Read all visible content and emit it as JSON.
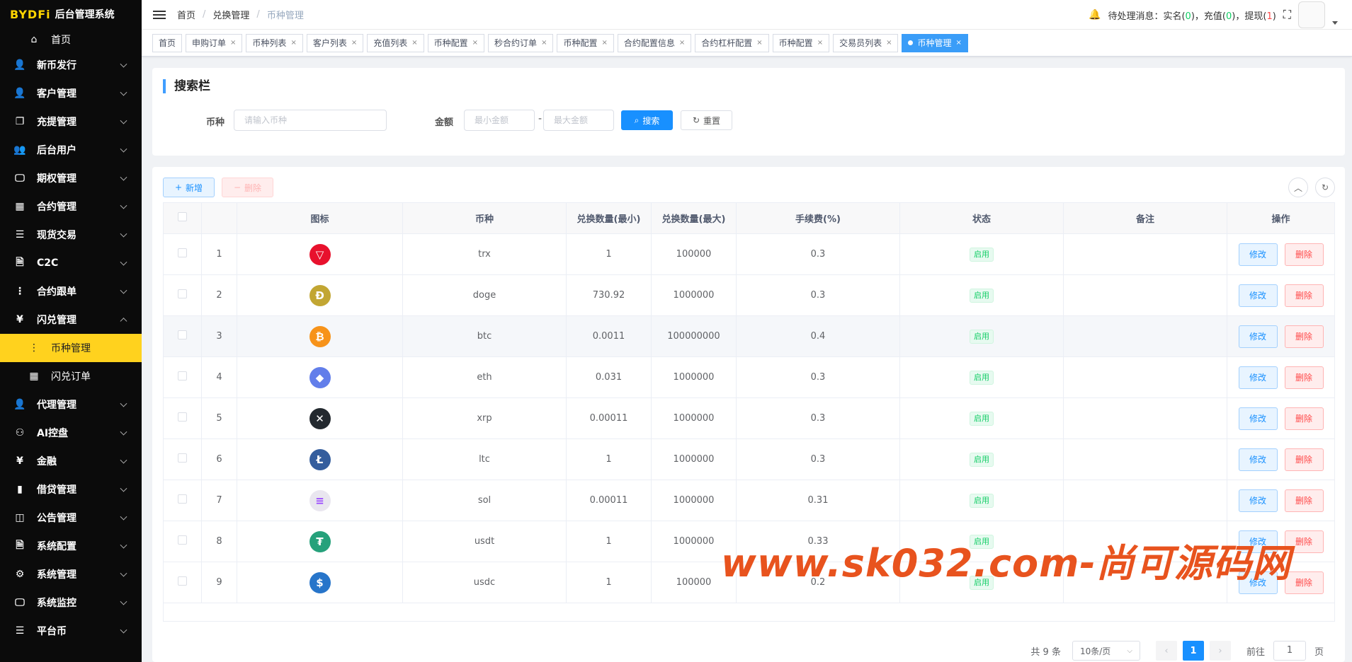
{
  "brand": {
    "logo": "BYDFi",
    "title": "后台管理系统"
  },
  "sidebar": {
    "home": "首页",
    "items": [
      {
        "label": "新币发行",
        "icon": "user-icon"
      },
      {
        "label": "客户管理",
        "icon": "user-icon"
      },
      {
        "label": "充提管理",
        "icon": "copy-icon"
      },
      {
        "label": "后台用户",
        "icon": "users-icon"
      },
      {
        "label": "期权管理",
        "icon": "monitor-icon"
      },
      {
        "label": "合约管理",
        "icon": "table-icon"
      },
      {
        "label": "现货交易",
        "icon": "list-icon"
      },
      {
        "label": "C2C",
        "icon": "document-icon"
      },
      {
        "label": "合约跟单",
        "icon": "tree-icon"
      },
      {
        "label": "闪兑管理",
        "icon": "yen-icon"
      }
    ],
    "sub_items": [
      {
        "label": "币种管理",
        "icon": "tree-icon",
        "active": true
      },
      {
        "label": "闪兑订单",
        "icon": "table-icon",
        "active": false
      }
    ],
    "items_after": [
      {
        "label": "代理管理",
        "icon": "user-icon"
      },
      {
        "label": "AI控盘",
        "icon": "robot-icon"
      },
      {
        "label": "金融",
        "icon": "yen-icon"
      },
      {
        "label": "借贷管理",
        "icon": "book-icon"
      },
      {
        "label": "公告管理",
        "icon": "book-open-icon"
      },
      {
        "label": "系统配置",
        "icon": "document-icon"
      },
      {
        "label": "系统管理",
        "icon": "gear-icon"
      },
      {
        "label": "系统监控",
        "icon": "monitor-icon"
      },
      {
        "label": "平台币",
        "icon": "list-icon"
      }
    ]
  },
  "header": {
    "breadcrumb": [
      "首页",
      "兑换管理",
      "币种管理"
    ],
    "notice_label": "待处理消息：",
    "realname_label": "实名(",
    "realname_count": "0",
    "recharge_label": "充值(",
    "recharge_count": "0",
    "withdraw_label": "提现(",
    "withdraw_count": "1",
    "close_paren": ")"
  },
  "tags": [
    {
      "label": "首页",
      "closable": false
    },
    {
      "label": "申购订单",
      "closable": true
    },
    {
      "label": "币种列表",
      "closable": true
    },
    {
      "label": "客户列表",
      "closable": true
    },
    {
      "label": "充值列表",
      "closable": true
    },
    {
      "label": "币种配置",
      "closable": true
    },
    {
      "label": "秒合约订单",
      "closable": true
    },
    {
      "label": "币种配置",
      "closable": true
    },
    {
      "label": "合约配置信息",
      "closable": true
    },
    {
      "label": "合约杠杆配置",
      "closable": true
    },
    {
      "label": "币种配置",
      "closable": true
    },
    {
      "label": "交易员列表",
      "closable": true
    },
    {
      "label": "币种管理",
      "closable": true,
      "active": true
    }
  ],
  "search": {
    "title": "搜索栏",
    "coin_label": "币种",
    "coin_placeholder": "请输入币种",
    "amount_label": "金额",
    "min_placeholder": "最小金额",
    "max_placeholder": "最大金额",
    "dash": "-",
    "search_btn": "搜索",
    "reset_btn": "重置"
  },
  "toolbar": {
    "add_btn": "新增",
    "delete_btn": "删除"
  },
  "table": {
    "columns": [
      "",
      "",
      "图标",
      "币种",
      "兑换数量(最小)",
      "兑换数量(最大)",
      "手续费(%)",
      "状态",
      "备注",
      "操作"
    ],
    "edit_label": "修改",
    "delete_label": "删除",
    "rows": [
      {
        "idx": "1",
        "coin": "trx",
        "min": "1",
        "max": "100000",
        "fee": "0.3",
        "status": "启用",
        "remark": "",
        "icon_color": "#e8112d",
        "icon_glyph": "▽"
      },
      {
        "idx": "2",
        "coin": "doge",
        "min": "730.92",
        "max": "1000000",
        "fee": "0.3",
        "status": "启用",
        "remark": "",
        "icon_color": "#c2a633",
        "icon_glyph": "Ð"
      },
      {
        "idx": "3",
        "coin": "btc",
        "min": "0.0011",
        "max": "100000000",
        "fee": "0.4",
        "status": "启用",
        "remark": "",
        "icon_color": "#f7931a",
        "icon_glyph": "₿"
      },
      {
        "idx": "4",
        "coin": "eth",
        "min": "0.031",
        "max": "1000000",
        "fee": "0.3",
        "status": "启用",
        "remark": "",
        "icon_color": "#627eea",
        "icon_glyph": "◆"
      },
      {
        "idx": "5",
        "coin": "xrp",
        "min": "0.00011",
        "max": "1000000",
        "fee": "0.3",
        "status": "启用",
        "remark": "",
        "icon_color": "#23292f",
        "icon_glyph": "✕"
      },
      {
        "idx": "6",
        "coin": "ltc",
        "min": "1",
        "max": "1000000",
        "fee": "0.3",
        "status": "启用",
        "remark": "",
        "icon_color": "#345d9d",
        "icon_glyph": "Ł"
      },
      {
        "idx": "7",
        "coin": "sol",
        "min": "0.00011",
        "max": "1000000",
        "fee": "0.31",
        "status": "启用",
        "remark": "",
        "icon_color": "#e9e6ef",
        "icon_glyph": "≡"
      },
      {
        "idx": "8",
        "coin": "usdt",
        "min": "1",
        "max": "1000000",
        "fee": "0.33",
        "status": "启用",
        "remark": "",
        "icon_color": "#26a17b",
        "icon_glyph": "₮"
      },
      {
        "idx": "9",
        "coin": "usdc",
        "min": "1",
        "max": "100000",
        "fee": "0.2",
        "status": "启用",
        "remark": "",
        "icon_color": "#2775ca",
        "icon_glyph": "$"
      }
    ]
  },
  "pagination": {
    "total": "共 9 条",
    "page_size": "10条/页",
    "current": "1",
    "goto_label": "前往",
    "goto_value": "1",
    "page_unit": "页"
  },
  "watermark": "www.sk032.com-尚可源码网"
}
